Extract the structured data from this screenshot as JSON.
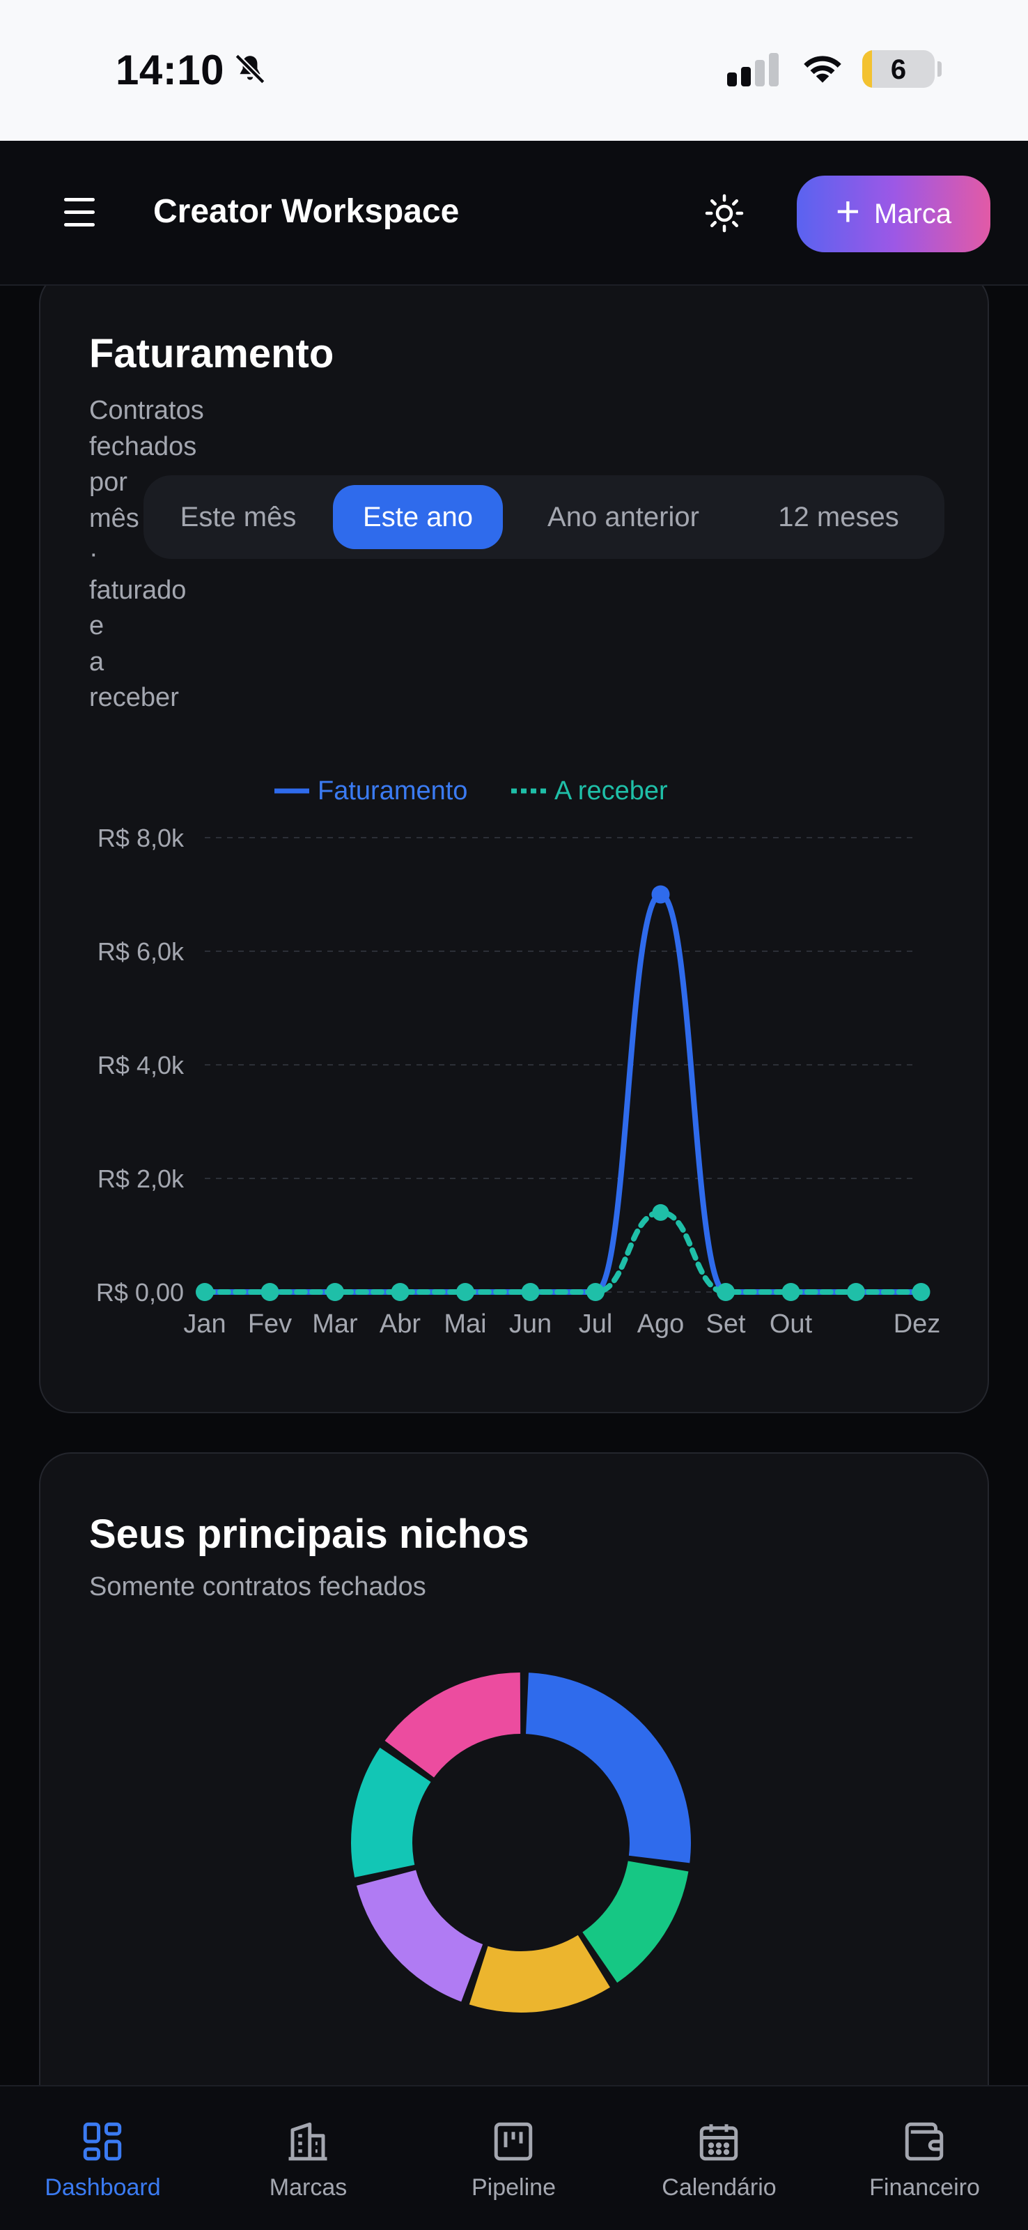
{
  "status_bar": {
    "time": "14:10",
    "battery": "6"
  },
  "header": {
    "title": "Creator Workspace",
    "new_brand_button": "Marca"
  },
  "revenue_card": {
    "title": "Faturamento",
    "subtitle_lines": [
      "Contratos",
      "fechados",
      "por",
      "mês",
      "·",
      "faturado",
      "e",
      "a",
      "receber"
    ],
    "periods": [
      "Este mês",
      "Este ano",
      "Ano anterior",
      "12 meses"
    ],
    "active_period": "Este ano",
    "legend": [
      "Faturamento",
      "A receber"
    ]
  },
  "chart_data": {
    "type": "line",
    "categories": [
      "Jan",
      "Fev",
      "Mar",
      "Abr",
      "Mai",
      "Jun",
      "Jul",
      "Ago",
      "Set",
      "Out",
      "",
      "Dez"
    ],
    "y_ticks": [
      "R$ 0,00",
      "R$ 2,0k",
      "R$ 4,0k",
      "R$ 6,0k",
      "R$ 8,0k"
    ],
    "ylim": [
      0,
      8000
    ],
    "grid": true,
    "legend_position": "top-center",
    "series": [
      {
        "name": "Faturamento",
        "color": "#2f6bec",
        "style": "solid",
        "values": [
          0,
          0,
          0,
          0,
          0,
          0,
          0,
          7000,
          0,
          0,
          0,
          0
        ]
      },
      {
        "name": "A receber",
        "color": "#1fbfa8",
        "style": "dashed",
        "values": [
          0,
          0,
          0,
          0,
          0,
          0,
          0,
          1400,
          0,
          0,
          0,
          0
        ]
      }
    ]
  },
  "niche_card": {
    "title": "Seus principais nichos",
    "subtitle": "Somente contratos fechados",
    "segment_colors": [
      "#2f6bec",
      "#16c784",
      "#ecb52e",
      "#b07bf3",
      "#12c6b5",
      "#ec4c9f"
    ],
    "segment_shares": [
      0.27,
      0.135,
      0.145,
      0.16,
      0.135,
      0.155
    ]
  },
  "bottom_nav": {
    "items": [
      {
        "label": "Dashboard",
        "icon": "dashboard-icon"
      },
      {
        "label": "Marcas",
        "icon": "building-icon"
      },
      {
        "label": "Pipeline",
        "icon": "kanban-icon"
      },
      {
        "label": "Calendário",
        "icon": "calendar-icon"
      },
      {
        "label": "Financeiro",
        "icon": "wallet-icon"
      }
    ],
    "active": "Dashboard"
  }
}
